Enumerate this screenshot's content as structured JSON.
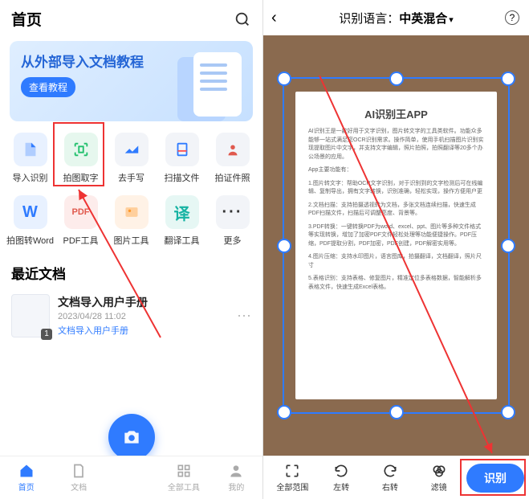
{
  "left": {
    "title": "首页",
    "banner": {
      "title": "从外部导入文档教程",
      "cta": "查看教程"
    },
    "tools": [
      {
        "label": "导入识别",
        "name": "tool-import"
      },
      {
        "label": "拍图取字",
        "name": "tool-capture"
      },
      {
        "label": "去手写",
        "name": "tool-dehandwrite"
      },
      {
        "label": "扫描文件",
        "name": "tool-scan"
      },
      {
        "label": "拍证件照",
        "name": "tool-idphoto"
      },
      {
        "label": "拍图转Word",
        "name": "tool-toword"
      },
      {
        "label": "PDF工具",
        "name": "tool-pdf"
      },
      {
        "label": "图片工具",
        "name": "tool-image"
      },
      {
        "label": "翻译工具",
        "name": "tool-translate"
      },
      {
        "label": "更多",
        "name": "tool-more"
      }
    ],
    "recent_title": "最近文档",
    "doc": {
      "name": "文档导入用户手册",
      "date": "2023/04/28 11:02",
      "tag": "文档导入用户手册",
      "badge": "1"
    },
    "nav": {
      "home": "首页",
      "docs": "文档",
      "tools": "全部工具",
      "me": "我的"
    }
  },
  "right": {
    "lang_label": "识别语言：",
    "lang_value": "中英混合",
    "paper_title": "AI识别王APP",
    "paper_sub": "App主要功能有：",
    "nav": {
      "full": "全部范围",
      "rleft": "左转",
      "rright": "右转",
      "filter": "滤镜",
      "go": "识别"
    }
  }
}
